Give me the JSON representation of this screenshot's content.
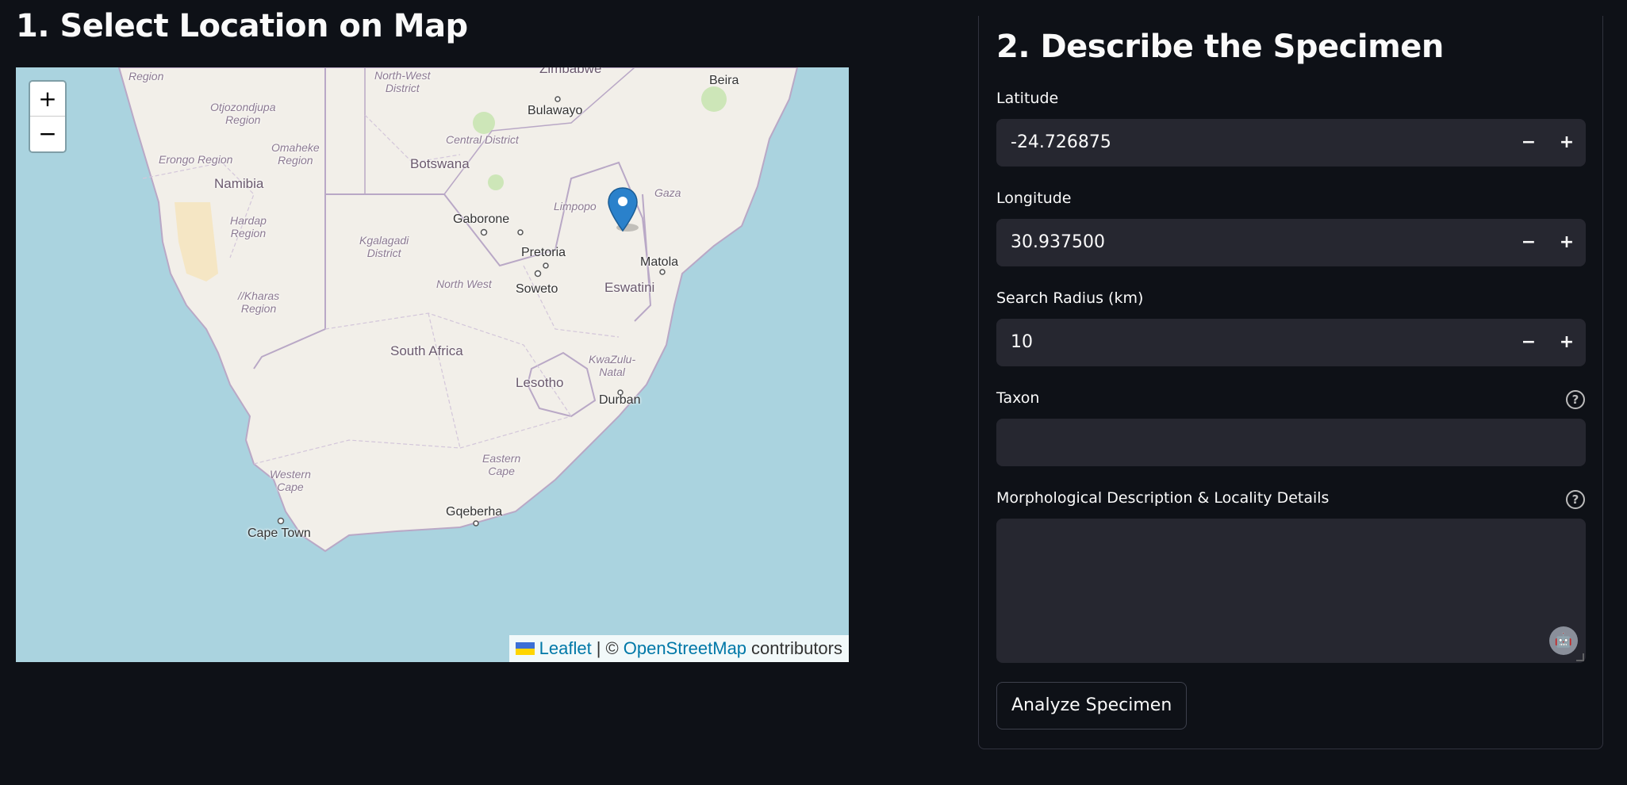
{
  "left": {
    "title": "1. Select Location on Map"
  },
  "map": {
    "zoom_in": "+",
    "zoom_out": "−",
    "labels": {
      "zimbabwe": "Zimbabwe",
      "beira": "Beira",
      "region": "Region",
      "north_west_district": "North-West\nDistrict",
      "otjozondjupa": "Otjozondjupa\nRegion",
      "bulawayo": "Bulawayo",
      "omaheke": "Omaheke\nRegion",
      "central_district": "Central District",
      "erongo": "Erongo Region",
      "botswana": "Botswana",
      "namibia": "Namibia",
      "gaza": "Gaza",
      "limpopo": "Limpopo",
      "hardap": "Hardap\nRegion",
      "gaborone": "Gaborone",
      "kgalagadi": "Kgalagadi\nDistrict",
      "pretoria": "Pretoria",
      "matola": "Matola",
      "north_west": "North West",
      "soweto": "Soweto",
      "eswatini": "Eswatini",
      "karas": "//Kharas\nRegion",
      "south_africa": "South Africa",
      "kwazulu": "KwaZulu-\nNatal",
      "lesotho": "Lesotho",
      "durban": "Durban",
      "eastern_cape": "Eastern\nCape",
      "western_cape": "Western\nCape",
      "gqeberha": "Gqeberha",
      "cape_town": "Cape Town"
    },
    "attribution": {
      "leaflet": "Leaflet",
      "separator": "| ©",
      "osm": "OpenStreetMap",
      "contributors": "contributors"
    }
  },
  "form": {
    "title": "2. Describe the Specimen",
    "latitude": {
      "label": "Latitude",
      "value": "-24.726875"
    },
    "longitude": {
      "label": "Longitude",
      "value": "30.937500"
    },
    "radius": {
      "label": "Search Radius (km)",
      "value": "10"
    },
    "taxon": {
      "label": "Taxon",
      "value": ""
    },
    "description": {
      "label": "Morphological Description & Locality Details",
      "value": ""
    },
    "minus": "−",
    "plus": "+",
    "help": "?",
    "analyze_button": "Analyze Specimen"
  },
  "colors": {
    "background": "#0e1117",
    "input_bg": "#262730",
    "water": "#aad3df",
    "land": "#f2efe9",
    "marker": "#2a81cb"
  }
}
